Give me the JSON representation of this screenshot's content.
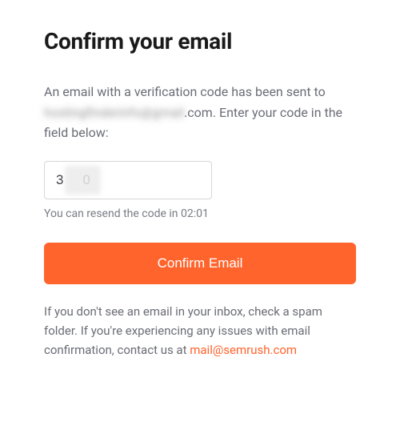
{
  "title": "Confirm your email",
  "instruction": {
    "prefix": "An email with a verification code has been sent to ",
    "redacted_email_part": "hostingfinderinfo@gmail",
    "email_suffix": ".com",
    "suffix": ". Enter your code in the field below:"
  },
  "code": {
    "value": "3    0",
    "resend_prefix": "You can resend the code in ",
    "resend_timer": "02:01"
  },
  "confirm_button_label": "Confirm Email",
  "help": {
    "text": "If you don't see an email in your inbox, check a spam folder. If you're experiencing any issues with email confirmation, contact us at ",
    "email": "mail@semrush.com"
  }
}
